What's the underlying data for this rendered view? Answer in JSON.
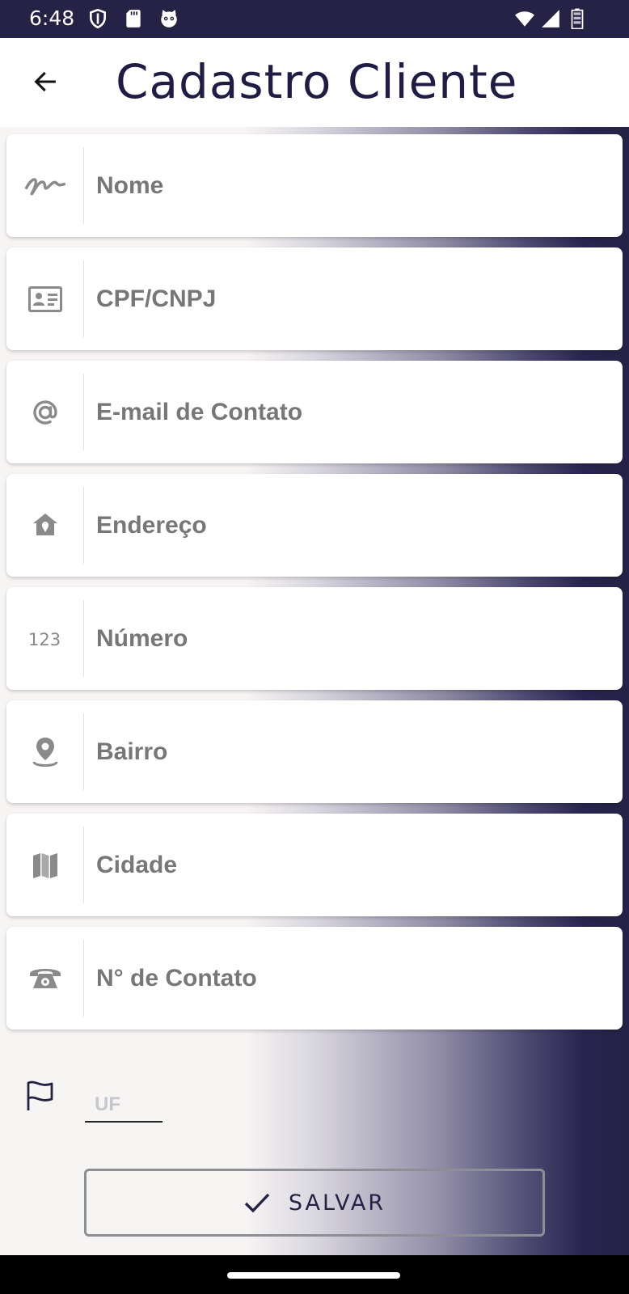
{
  "status_bar": {
    "time": "6:48",
    "icons": [
      "shield-icon",
      "sd-card-icon",
      "cat-icon",
      "wifi-icon",
      "signal-icon",
      "battery-icon"
    ],
    "background_color": "#252246"
  },
  "app_bar": {
    "back_icon": "arrow-back-icon",
    "title": "Cadastro Cliente",
    "title_color": "#1f1c45"
  },
  "form": {
    "fields": [
      {
        "icon": "signature-icon",
        "placeholder": "Nome",
        "value": ""
      },
      {
        "icon": "id-card-icon",
        "placeholder": "CPF/CNPJ",
        "value": ""
      },
      {
        "icon": "at-sign-icon",
        "placeholder": "E-mail de Contato",
        "value": ""
      },
      {
        "icon": "home-pin-icon",
        "placeholder": "Endereço",
        "value": ""
      },
      {
        "icon": "numbers-icon",
        "placeholder": "Número",
        "value": ""
      },
      {
        "icon": "location-pin-icon",
        "placeholder": "Bairro",
        "value": ""
      },
      {
        "icon": "map-icon",
        "placeholder": "Cidade",
        "value": ""
      },
      {
        "icon": "telephone-icon",
        "placeholder": "N° de Contato",
        "value": ""
      }
    ],
    "uf": {
      "icon": "flag-icon",
      "placeholder": "UF",
      "value": ""
    }
  },
  "actions": {
    "save_icon": "check-icon",
    "save_label": "SALVAR"
  },
  "colors": {
    "brand_dark": "#252246",
    "label_gray": "#777777",
    "background": "#f7f4f4"
  }
}
